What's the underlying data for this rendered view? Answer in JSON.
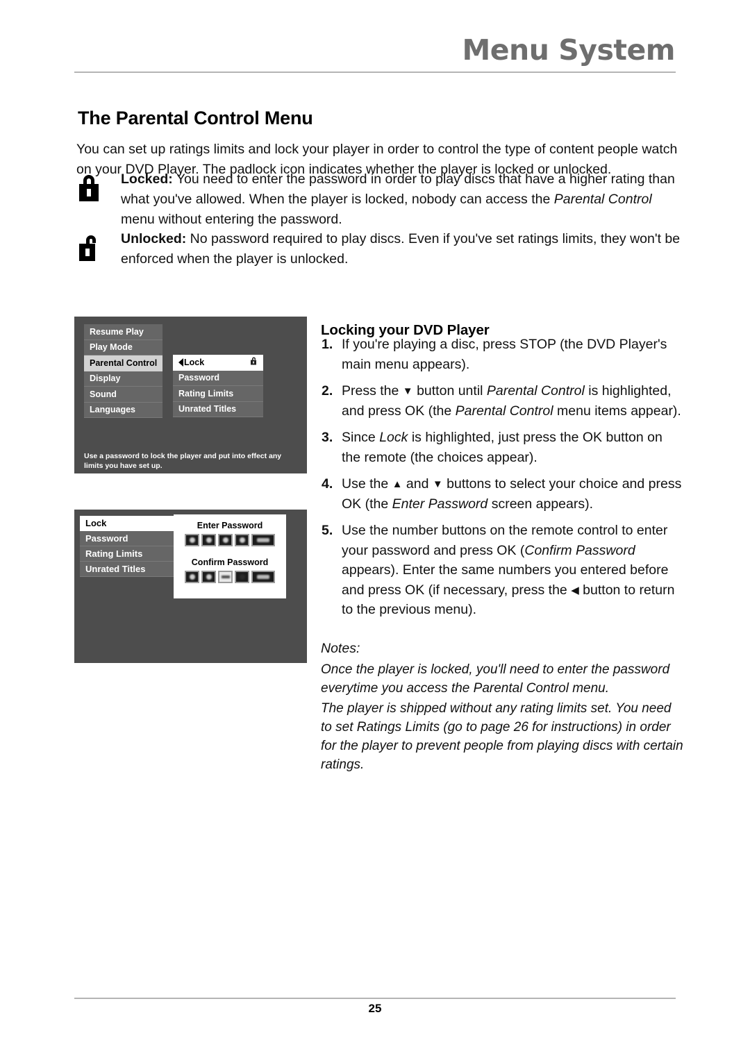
{
  "header": {
    "title": "Menu System"
  },
  "doc": {
    "title": "The Parental Control Menu",
    "intro": "You can set up ratings limits and lock your player in order to control the type of content people watch on your DVD Player. The padlock icon indicates whether the player is locked or unlocked."
  },
  "lock_notes": [
    {
      "icon": "padlock-closed-icon",
      "label": "Locked:",
      "text_1": " You need to enter the password in order to play discs that have a higher rating than what you've allowed. When the player is locked, nobody can access the ",
      "italic_1": "Parental Control",
      "text_2": " menu without entering the password."
    },
    {
      "icon": "padlock-open-icon",
      "label": "Unlocked:",
      "text_1": " No password required to play discs. Even if you've set ratings limits, they won't be enforced when the player is unlocked.",
      "italic_1": "",
      "text_2": ""
    }
  ],
  "dvd_screen_1": {
    "main_menu": [
      {
        "label": "Resume Play",
        "selected": false
      },
      {
        "label": "Play Mode",
        "selected": false
      },
      {
        "label": "Parental Control",
        "selected": true
      },
      {
        "label": "Display",
        "selected": false
      },
      {
        "label": "Sound",
        "selected": false
      },
      {
        "label": "Languages",
        "selected": false
      }
    ],
    "submenu": [
      {
        "label": "Lock",
        "selected": true
      },
      {
        "label": "Password",
        "selected": false
      },
      {
        "label": "Rating Limits",
        "selected": false
      },
      {
        "label": "Unrated Titles",
        "selected": false
      }
    ],
    "caption": "Use a password to lock the player and put into effect any limits you have set up."
  },
  "dvd_screen_2": {
    "menu": [
      {
        "label": "Lock",
        "selected": true
      },
      {
        "label": "Password",
        "selected": false
      },
      {
        "label": "Rating Limits",
        "selected": false
      },
      {
        "label": "Unrated Titles",
        "selected": false
      }
    ],
    "enter_password_label": "Enter Password",
    "confirm_password_label": "Confirm Password"
  },
  "right_column": {
    "heading": "Locking your DVD Player",
    "steps": [
      {
        "num": "1.",
        "parts": [
          {
            "t": "If you're playing a disc, press STOP (the DVD Player's main menu appears).",
            "style": "normal"
          }
        ]
      },
      {
        "num": "2.",
        "parts": [
          {
            "t": "Press the ",
            "style": "normal"
          },
          {
            "t": "▼",
            "style": "glyph"
          },
          {
            "t": " button until ",
            "style": "normal"
          },
          {
            "t": "Parental Control",
            "style": "italic"
          },
          {
            "t": " is highlighted, and press OK (the ",
            "style": "normal"
          },
          {
            "t": "Parental Control",
            "style": "italic"
          },
          {
            "t": " menu items appear).",
            "style": "normal"
          }
        ]
      },
      {
        "num": "3.",
        "parts": [
          {
            "t": "Since ",
            "style": "normal"
          },
          {
            "t": "Lock",
            "style": "italic"
          },
          {
            "t": " is highlighted, just press the OK button on the remote (the choices appear).",
            "style": "normal"
          }
        ]
      },
      {
        "num": "4.",
        "parts": [
          {
            "t": "Use the ",
            "style": "normal"
          },
          {
            "t": "▲",
            "style": "glyph"
          },
          {
            "t": " and ",
            "style": "normal"
          },
          {
            "t": "▼",
            "style": "glyph"
          },
          {
            "t": " buttons to select your choice and press OK (the ",
            "style": "normal"
          },
          {
            "t": "Enter Password",
            "style": "italic"
          },
          {
            "t": " screen appears).",
            "style": "normal"
          }
        ]
      },
      {
        "num": "5.",
        "parts": [
          {
            "t": "Use the number buttons on the remote control to enter your password and press OK (",
            "style": "normal"
          },
          {
            "t": "Confirm Password",
            "style": "italic"
          },
          {
            "t": " appears). Enter the same numbers you entered before and press OK (if necessary, press the ",
            "style": "normal"
          },
          {
            "t": "◀",
            "style": "glyph"
          },
          {
            "t": " button to return to the previous menu).",
            "style": "normal"
          }
        ]
      }
    ],
    "notes_label": "Notes:",
    "notes": [
      "Once the player is locked, you'll need to enter the password everytime you access the Parental Control menu.",
      "The player is shipped without any rating limits set. You need to set Ratings Limits (go to page 26 for instructions) in order for the player to prevent people from playing discs with certain ratings."
    ]
  },
  "footer": {
    "page_number": "25"
  },
  "colors": {
    "header_gray": "#6e6e6e",
    "panel_bg": "#4d4d4d",
    "row_bg": "#666666",
    "row_selected": "#d2d2d2",
    "rule": "#b4b4b4"
  }
}
